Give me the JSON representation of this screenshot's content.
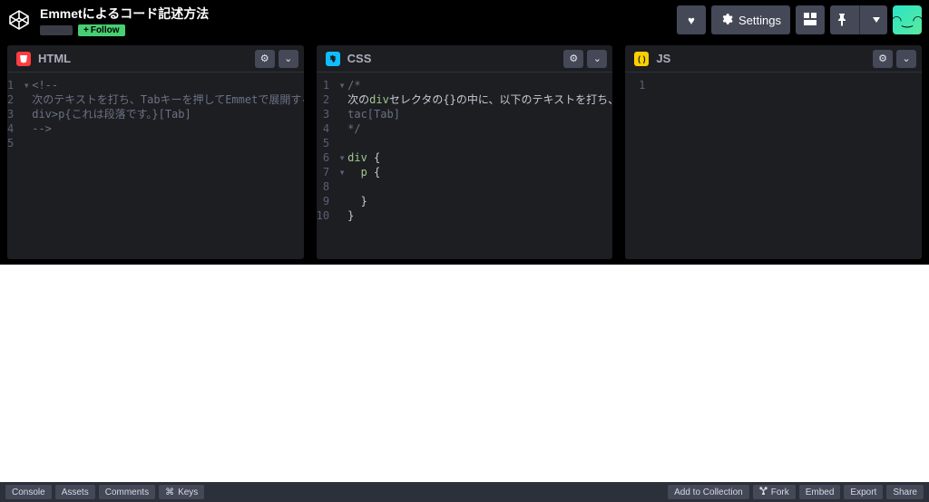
{
  "header": {
    "title": "Emmetによるコード記述方法",
    "follow_label": "Follow",
    "settings_label": "Settings"
  },
  "editors": {
    "html": {
      "label": "HTML",
      "lines": [
        {
          "n": 1,
          "marker": "▾",
          "text": "<!--"
        },
        {
          "n": 2,
          "marker": "",
          "text": "次のテキストを打ち、Tabキーを押してEmmetで展開する。"
        },
        {
          "n": 3,
          "marker": "",
          "text": "div>p{これは段落です。}[Tab]"
        },
        {
          "n": 4,
          "marker": "",
          "text": "-->"
        },
        {
          "n": 5,
          "marker": "",
          "text": ""
        }
      ]
    },
    "css": {
      "label": "CSS",
      "lines": [
        {
          "n": 1,
          "marker": "▾",
          "text": "/*"
        },
        {
          "n": 2,
          "marker": "",
          "text": "次のdivセレクタの{}の中に、以下のテキストを打ち、Tabキーを押してEmmetで展開する。"
        },
        {
          "n": 3,
          "marker": "",
          "text": "tac[Tab]"
        },
        {
          "n": 4,
          "marker": "",
          "text": "*/"
        },
        {
          "n": 5,
          "marker": "",
          "text": ""
        },
        {
          "n": 6,
          "marker": "▾",
          "text": "div {"
        },
        {
          "n": 7,
          "marker": "▾",
          "text": "  p {"
        },
        {
          "n": 8,
          "marker": "",
          "text": ""
        },
        {
          "n": 9,
          "marker": "",
          "text": "  }"
        },
        {
          "n": 10,
          "marker": "",
          "text": "}"
        }
      ]
    },
    "js": {
      "label": "JS",
      "lines": [
        {
          "n": 1,
          "marker": "",
          "text": ""
        }
      ]
    }
  },
  "footer": {
    "console": "Console",
    "assets": "Assets",
    "comments": "Comments",
    "keys": "Keys",
    "add_collection": "Add to Collection",
    "fork": "Fork",
    "embed": "Embed",
    "export": "Export",
    "share": "Share"
  }
}
